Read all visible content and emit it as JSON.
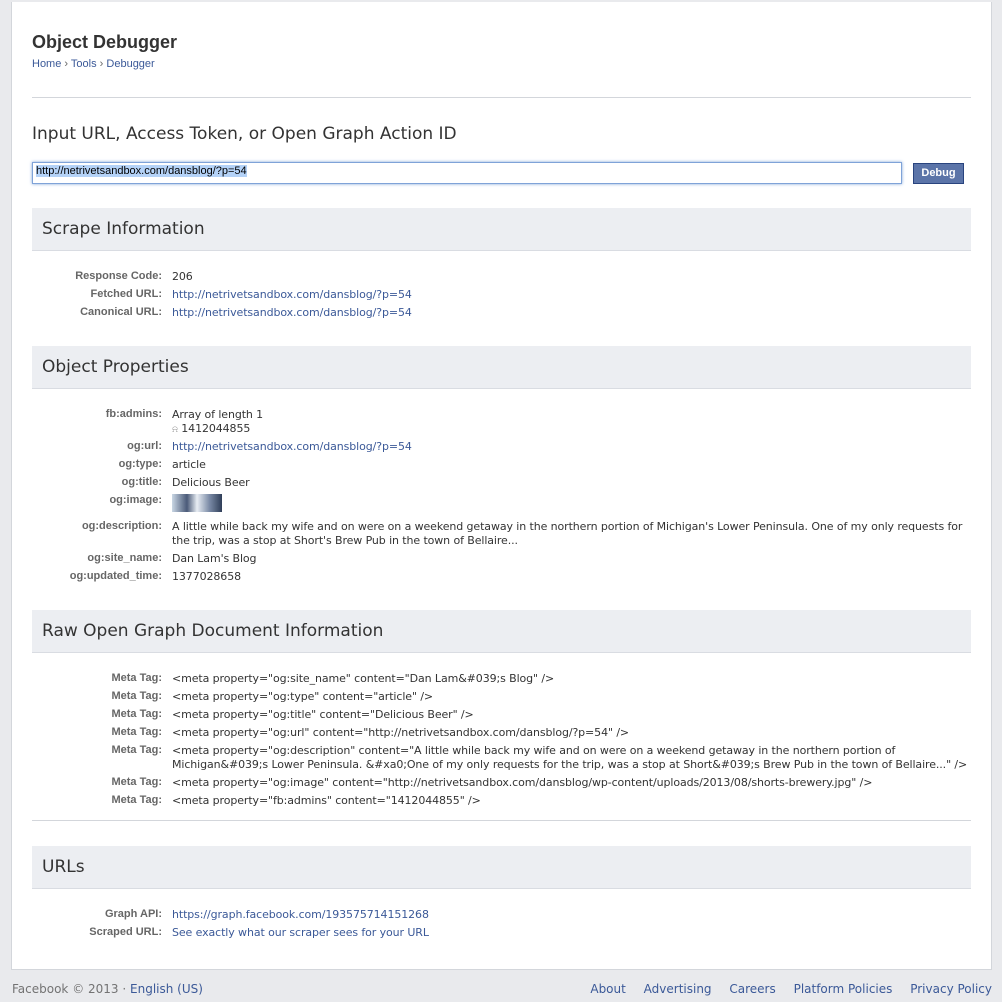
{
  "header": {
    "title": "Object Debugger",
    "breadcrumb": [
      "Home",
      "Tools",
      "Debugger"
    ]
  },
  "input": {
    "label": "Input URL, Access Token, or Open Graph Action ID",
    "value": "http://netrivetsandbox.com/dansblog/?p=54",
    "button": "Debug"
  },
  "scrape": {
    "title": "Scrape Information",
    "rows": [
      {
        "key": "Response Code:",
        "value": "206"
      },
      {
        "key": "Fetched URL:",
        "value": "http://netrivetsandbox.com/dansblog/?p=54"
      },
      {
        "key": "Canonical URL:",
        "value": "http://netrivetsandbox.com/dansblog/?p=54"
      }
    ]
  },
  "properties": {
    "title": "Object Properties",
    "admins_key": "fb:admins:",
    "admins_value": "Array of length 1",
    "admins_item": "1412044855",
    "url_key": "og:url:",
    "url_value": "http://netrivetsandbox.com/dansblog/?p=54",
    "type_key": "og:type:",
    "type_value": "article",
    "title_key": "og:title:",
    "title_value": "Delicious Beer",
    "image_key": "og:image:",
    "desc_key": "og:description:",
    "desc_value": "A little while back my wife and on were on a weekend getaway in the northern portion of Michigan's Lower Peninsula. One of my only requests for the trip, was a stop at Short's Brew Pub in the town of Bellaire...",
    "site_key": "og:site_name:",
    "site_value": "Dan Lam's Blog",
    "updated_key": "og:updated_time:",
    "updated_value": "1377028658"
  },
  "raw": {
    "title": "Raw Open Graph Document Information",
    "key": "Meta Tag:",
    "tags": [
      "<meta property=\"og:site_name\" content=\"Dan Lam&#039;s Blog\" />",
      "<meta property=\"og:type\" content=\"article\" />",
      "<meta property=\"og:title\" content=\"Delicious Beer\" />",
      "<meta property=\"og:url\" content=\"http://netrivetsandbox.com/dansblog/?p=54\" />",
      "<meta property=\"og:description\" content=\"A little while back my wife and on were on a weekend getaway in the northern portion of Michigan&#039;s Lower Peninsula. &#xa0;One of my only requests for the trip, was a stop at Short&#039;s Brew Pub in the town of Bellaire...\" />",
      "<meta property=\"og:image\" content=\"http://netrivetsandbox.com/dansblog/wp-content/uploads/2013/08/shorts-brewery.jpg\" />",
      "<meta property=\"fb:admins\" content=\"1412044855\" />"
    ]
  },
  "urls": {
    "title": "URLs",
    "graph_key": "Graph API:",
    "graph_value": "https://graph.facebook.com/193575714151268",
    "scraped_key": "Scraped URL:",
    "scraped_value": "See exactly what our scraper sees for your URL"
  },
  "footer": {
    "copyright": "Facebook © 2013 ·",
    "language": "English (US)",
    "links": [
      "About",
      "Advertising",
      "Careers",
      "Platform Policies",
      "Privacy Policy"
    ]
  }
}
